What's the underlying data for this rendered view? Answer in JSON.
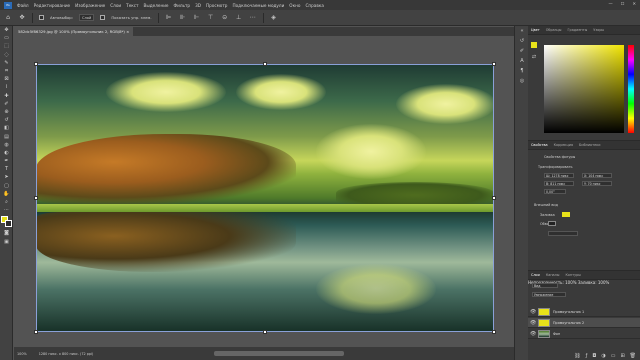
{
  "menu": {
    "logo": "Ps",
    "items": [
      "Файл",
      "Редактирование",
      "Изображение",
      "Слои",
      "Текст",
      "Выделение",
      "Фильтр",
      "3D",
      "Просмотр",
      "Подключаемые модули",
      "Окно",
      "Справка"
    ]
  },
  "window_controls": [
    "—",
    "☐",
    "✕"
  ],
  "options_bar": {
    "autoselect_label": "Автовыбор:",
    "layer_select": "Слой",
    "show_controls_label": "Показать упр. элем."
  },
  "document_tab": {
    "title": "582dc5f86329.jpg @ 100% (Прямоугольник 2, RGB/8*)",
    "close": "×"
  },
  "panels": {
    "color_tabs": [
      "Цвет",
      "Образцы",
      "Градиенты",
      "Узоры"
    ],
    "properties_tabs": [
      "Свойства",
      "Коррекция",
      "Библиотеки"
    ],
    "properties_title": "Свойства фигуры",
    "transform_label": "Трансформировать",
    "w_value": "Ш: 1278 пикс",
    "h_value": "В: 811 пикс",
    "x_value": "Х: 104 пикс",
    "y_value": "Y: 70 пикс",
    "angle_value": "0,00°",
    "appearance_label": "Внешний вид",
    "fill_label": "Заливка",
    "stroke_label": "Обводка",
    "layers_tabs": [
      "Слои",
      "Каналы",
      "Контуры"
    ],
    "layers_kind": "Вид",
    "blend_mode": "Умножение",
    "opacity_label": "Непрозрачность: 100%",
    "fill_pct": "Заливка: 100%",
    "layers": [
      {
        "name": "Прямоугольник 1",
        "selected": false
      },
      {
        "name": "Прямоугольник 2",
        "selected": true
      },
      {
        "name": "Фон",
        "selected": false
      }
    ]
  },
  "status": {
    "zoom": "100%",
    "doc_size": "1280 пикс. х 800 пикс. (72 ppi)"
  },
  "colors": {
    "foreground": "#e8e21a",
    "background": "#2c2c2c",
    "accent": "#2a6bb8"
  }
}
